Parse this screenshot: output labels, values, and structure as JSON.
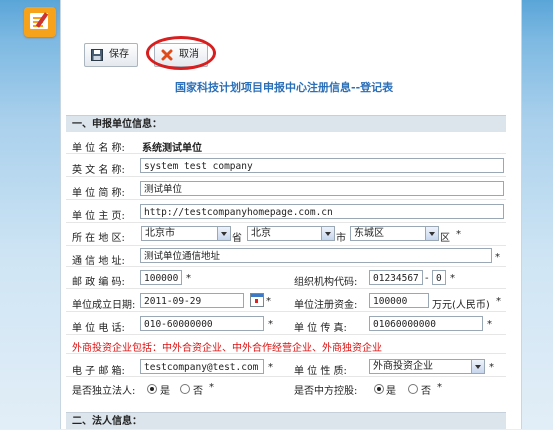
{
  "toolbar": {
    "save_label": "保存",
    "cancel_label": "取消"
  },
  "page_title": "国家科技计划项目申报中心注册信息--登记表",
  "section1": {
    "title": "一、申报单位信息："
  },
  "section2": {
    "title": "二、法人信息："
  },
  "fields": {
    "unit_name": {
      "label": "单 位 名 称:",
      "value": "系统测试单位"
    },
    "english_name": {
      "label": "英 文 名 称:",
      "value": "system test company"
    },
    "short_name": {
      "label": "单 位 简 称:",
      "value": "测试单位"
    },
    "homepage": {
      "label": "单 位 主 页:",
      "value": "http://testcompanyhomepage.com.cn"
    },
    "region": {
      "label": "所 在 地 区:",
      "province": "北京市",
      "province_unit": "省",
      "city": "北京",
      "city_unit": "市",
      "district": "东城区",
      "district_unit": "区"
    },
    "address": {
      "label": "通 信 地 址:",
      "value": "测试单位通信地址"
    },
    "postcode": {
      "label": "邮 政 编 码:",
      "value": "100000"
    },
    "org_code": {
      "label": "组织机构代码:",
      "value": "01234567",
      "check": "0"
    },
    "founded": {
      "label": "单位成立日期:",
      "value": "2011-09-29"
    },
    "capital": {
      "label": "单位注册资金:",
      "value": "100000",
      "unit": "万元(人民币)"
    },
    "phone": {
      "label": "单 位 电 话:",
      "value": "010-60000000"
    },
    "fax": {
      "label": "单 位 传 真:",
      "value": "01060000000"
    },
    "foreign_note": "外商投资企业包括：中外合资企业、中外合作经营企业、外商独资企业",
    "email": {
      "label": "电 子 邮 箱:",
      "value": "testcompany@test.com"
    },
    "nature": {
      "label": "单 位 性 质:",
      "value": "外商投资企业"
    },
    "independent": {
      "label": "是否独立法人:",
      "yes": "是",
      "no": "否"
    },
    "holding": {
      "label": "是否中方控股:",
      "yes": "是",
      "no": "否"
    }
  },
  "required_mark": "*",
  "colors": {
    "accent": "#2b6fb8",
    "required_note": "#d11111",
    "highlight_circle": "#d81e1e"
  }
}
